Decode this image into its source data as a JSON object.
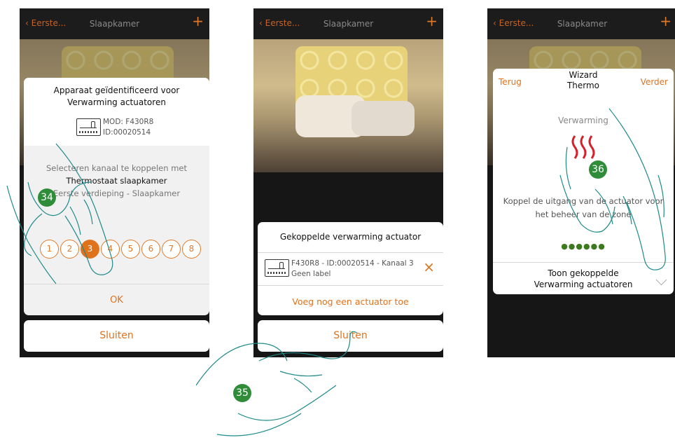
{
  "phone1": {
    "back_label": "Eerste...",
    "title": "Slaapkamer",
    "plus": "+",
    "dialog": {
      "heading_line1": "Apparaat geïdentificeerd voor",
      "heading_line2": "Verwarming actuatoren",
      "mod": "MOD: F430R8",
      "id": "ID:00020514",
      "select_text": "Selecteren kanaal te koppelen met",
      "thermostat": "Thermostaat slaapkamer",
      "location": "Eerste verdieping - Slaapkamer",
      "channels": [
        "1",
        "2",
        "3",
        "4",
        "5",
        "6",
        "7",
        "8"
      ],
      "selected_channel": "3",
      "ok_label": "OK"
    },
    "close_label": "Sluiten",
    "step_badge": "34"
  },
  "phone2": {
    "back_label": "Eerste...",
    "title": "Slaapkamer",
    "plus": "+",
    "dialog": {
      "heading": "Gekoppelde verwarming actuator",
      "item_line1": "F430R8 - ID:00020514 - Kanaal 3",
      "item_line2": "Geen label",
      "remove_icon": "×",
      "add_label": "Voeg nog een actuator toe"
    },
    "close_label": "Sluiten",
    "step_badge": "35"
  },
  "phone3": {
    "back_label": "Eerste...",
    "title": "Slaapkamer",
    "plus": "+",
    "wizard": {
      "back_label": "Terug",
      "title_line1": "Wizard",
      "title_line2": "Thermo",
      "next_label": "Verder",
      "heating_label": "Verwarming",
      "body_line1": "Koppel de uitgang van de actuator voor",
      "body_line2": "het beheer van de zone",
      "dots": "●●●●●●",
      "show_line1": "Toon gekoppelde",
      "show_line2": "Verwarming actuatoren"
    },
    "step_badge": "36"
  },
  "colors": {
    "accent": "#e0721c",
    "badge": "#2f8d3a",
    "dark": "#1a1a1a"
  }
}
